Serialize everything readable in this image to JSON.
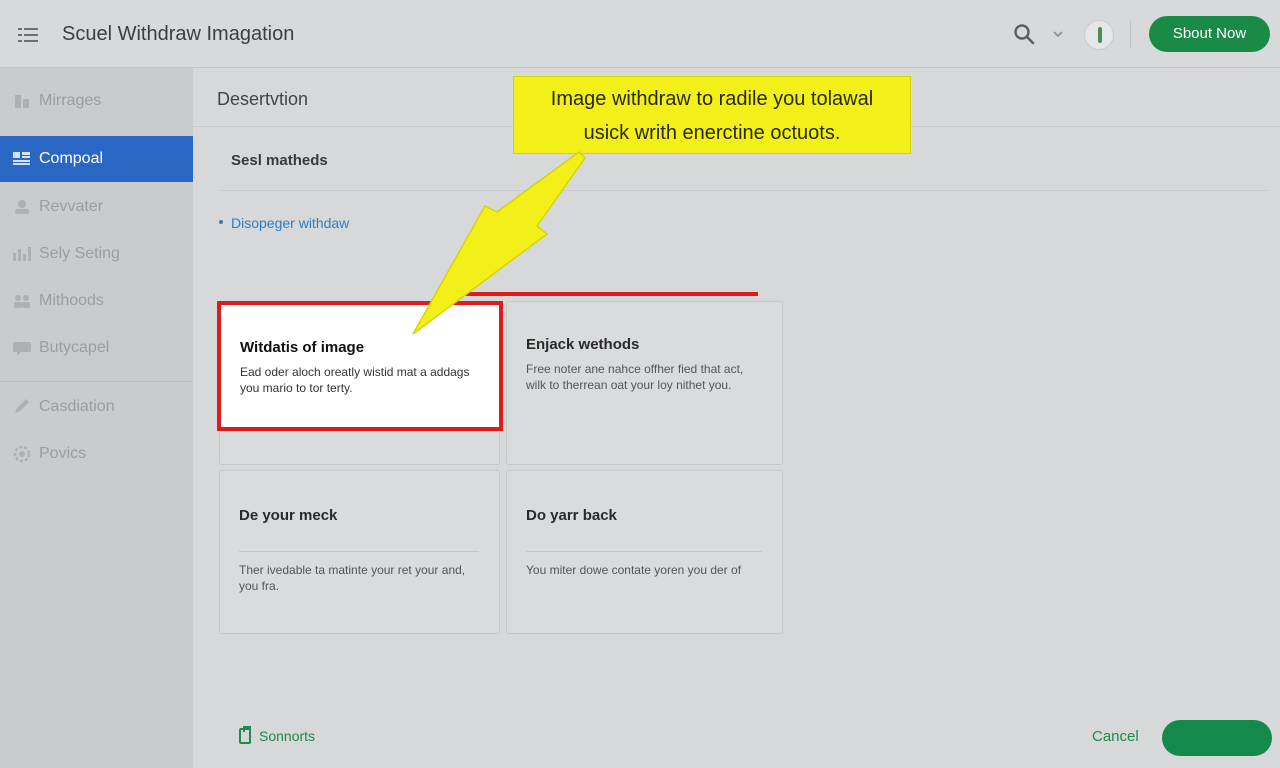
{
  "header": {
    "title": "Scuel Withdraw Imagation",
    "primary_button": "Sbout Now",
    "icons": [
      "menu-icon",
      "search-icon",
      "chevron-down-icon",
      "avatar"
    ]
  },
  "sidebar": {
    "items": [
      {
        "label": "Mirrages",
        "icon": "building-icon"
      },
      {
        "label": "Compoal",
        "icon": "grid-icon",
        "active": true
      },
      {
        "label": "Revvater",
        "icon": "user-icon"
      },
      {
        "label": "Sely Seting",
        "icon": "chart-icon"
      },
      {
        "label": "Mithoods",
        "icon": "people-icon"
      },
      {
        "label": "Butycapel",
        "icon": "chat-icon"
      },
      {
        "label": "Casdiation",
        "icon": "pencil-icon"
      },
      {
        "label": "Povics",
        "icon": "gear-icon"
      }
    ]
  },
  "main": {
    "section_title": "Desertvtion",
    "sub_title": "Sesl matheds",
    "link": "Disopeger withdaw",
    "callout": {
      "line1": "Image withdraw to radile you tolawal",
      "line2": "usick writh enerctine octuots."
    },
    "cards": [
      {
        "title": "Witdatis of image",
        "desc": "Ead oder aloch oreatly wistid mat a addags you mario to tor terty.",
        "highlighted": true
      },
      {
        "title": "Enjack wethods",
        "desc": "Free noter ane nahce offher fied that act, wilk to therrean oat your loy nithet you."
      },
      {
        "title": "De your meck",
        "desc": "Ther ivedable ta matinte your ret your and, you fra."
      },
      {
        "title": "Do yarr back",
        "desc": "You miter dowe contate yoren you der of"
      }
    ]
  },
  "footer": {
    "link": "Sonnorts",
    "cancel": "Cancel",
    "submit": ""
  },
  "colors": {
    "accent_green": "#1a8a47",
    "active_blue": "#2a66c4",
    "highlight_red": "#e01b1b",
    "callout_yellow": "#f3f019"
  }
}
